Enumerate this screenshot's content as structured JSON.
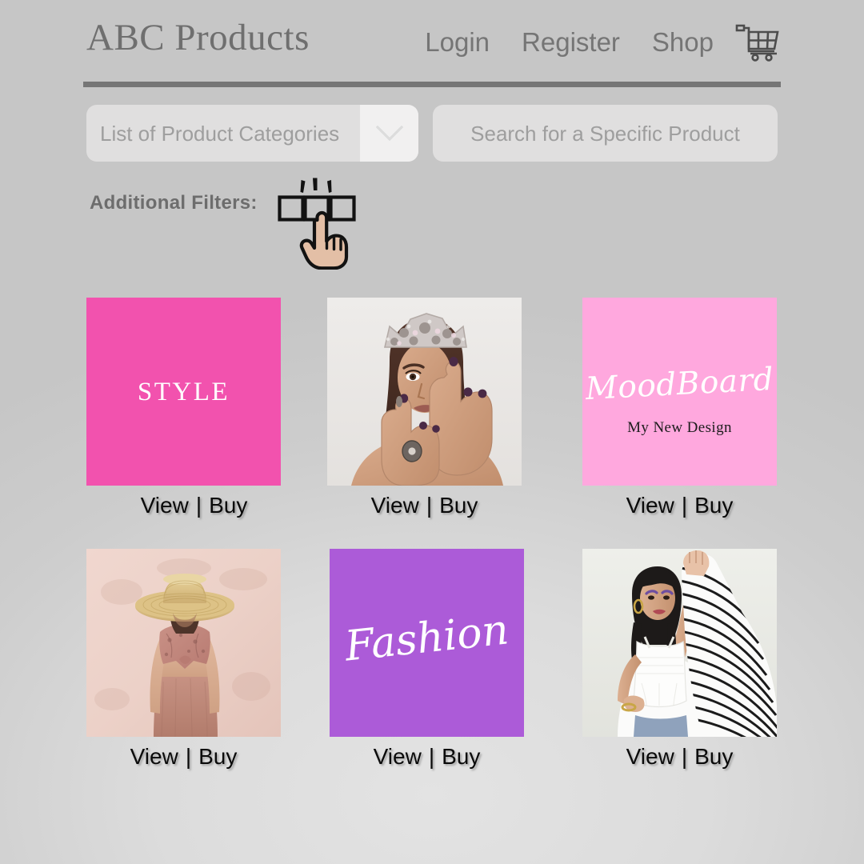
{
  "header": {
    "brand_title": "ABC Products",
    "nav": [
      {
        "label": "Login",
        "name": "nav-login"
      },
      {
        "label": "Register",
        "name": "nav-register"
      },
      {
        "label": "Shop",
        "name": "nav-shop"
      }
    ],
    "cart_icon": "shopping-cart-icon",
    "rule_color": "#767676",
    "title_color": "#6f6f6f"
  },
  "filters": {
    "category_select": {
      "placeholder": "List of Product Categories",
      "chevron_icon": "chevron-down-icon"
    },
    "search": {
      "placeholder": "Search for a Specific Product"
    },
    "additional_filters_label": "Additional Filters:",
    "toggle_icon": "three-checkboxes-tapped-icon"
  },
  "grid": {
    "action_view": "View",
    "action_separator": "|",
    "action_buy": "Buy",
    "cards": [
      {
        "id": "card-1",
        "kind": "color-tile",
        "color": "#f252ae",
        "title": "STYLE"
      },
      {
        "id": "card-2",
        "kind": "photo",
        "alt": "woman-wearing-jewelled-crown-covering-eye-with-hands"
      },
      {
        "id": "card-3",
        "kind": "color-tile",
        "color": "#ffa8de",
        "title": "MoodBoard",
        "subtitle": "My New Design"
      },
      {
        "id": "card-4",
        "kind": "photo",
        "alt": "woman-in-straw-hat-against-pink-wall"
      },
      {
        "id": "card-5",
        "kind": "color-tile",
        "color": "#ac5bd8",
        "title": "Fashion"
      },
      {
        "id": "card-6",
        "kind": "photo",
        "alt": "woman-in-white-top-with-arm-raised"
      }
    ]
  }
}
